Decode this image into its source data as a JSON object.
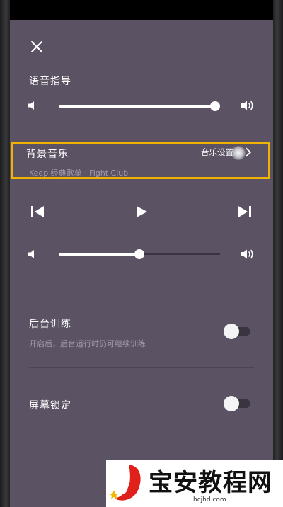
{
  "voice_guidance": {
    "title": "语音指导",
    "volume_value": 1.0
  },
  "background_music": {
    "title": "背景音乐",
    "subtitle": "Keep 经典歌单 · Fight Club",
    "settings_link": "音乐设置",
    "volume_value": 0.5
  },
  "background_training": {
    "title": "后台训练",
    "subtitle": "开启后，后台运行时仍可继续训练",
    "enabled": false
  },
  "screen_lock": {
    "title": "屏幕锁定",
    "enabled": false
  },
  "icons": {
    "close": "close-icon",
    "volume_low": "volume-low-icon",
    "volume_high": "volume-high-icon",
    "previous": "skip-previous-icon",
    "play": "play-icon",
    "next": "skip-next-icon",
    "chevron": "chevron-right-icon"
  },
  "colors": {
    "screen_background": "#5b5363",
    "highlight_border": "#f0b400",
    "muted_text": "#a49cab",
    "watermark_accent": "#e0201b"
  },
  "watermark": {
    "text": "宝安教程网",
    "url": "hcjhd.com"
  }
}
